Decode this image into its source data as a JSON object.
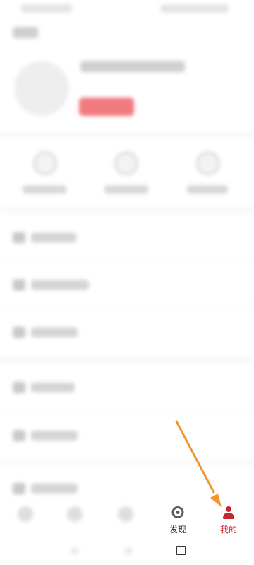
{
  "bottom_nav": {
    "items": [
      {
        "label": "",
        "icon": "placeholder-icon"
      },
      {
        "label": "",
        "icon": "placeholder-icon"
      },
      {
        "label": "",
        "icon": "placeholder-icon"
      },
      {
        "label": "发现",
        "icon": "discover-icon"
      },
      {
        "label": "我的",
        "icon": "person-icon",
        "active": true
      }
    ],
    "active_color": "#c8262e",
    "inactive_color": "#333333"
  },
  "annotation": {
    "color": "#f0962e",
    "points_to": "我的"
  },
  "profile": {
    "badge_color": "#f07a80"
  }
}
